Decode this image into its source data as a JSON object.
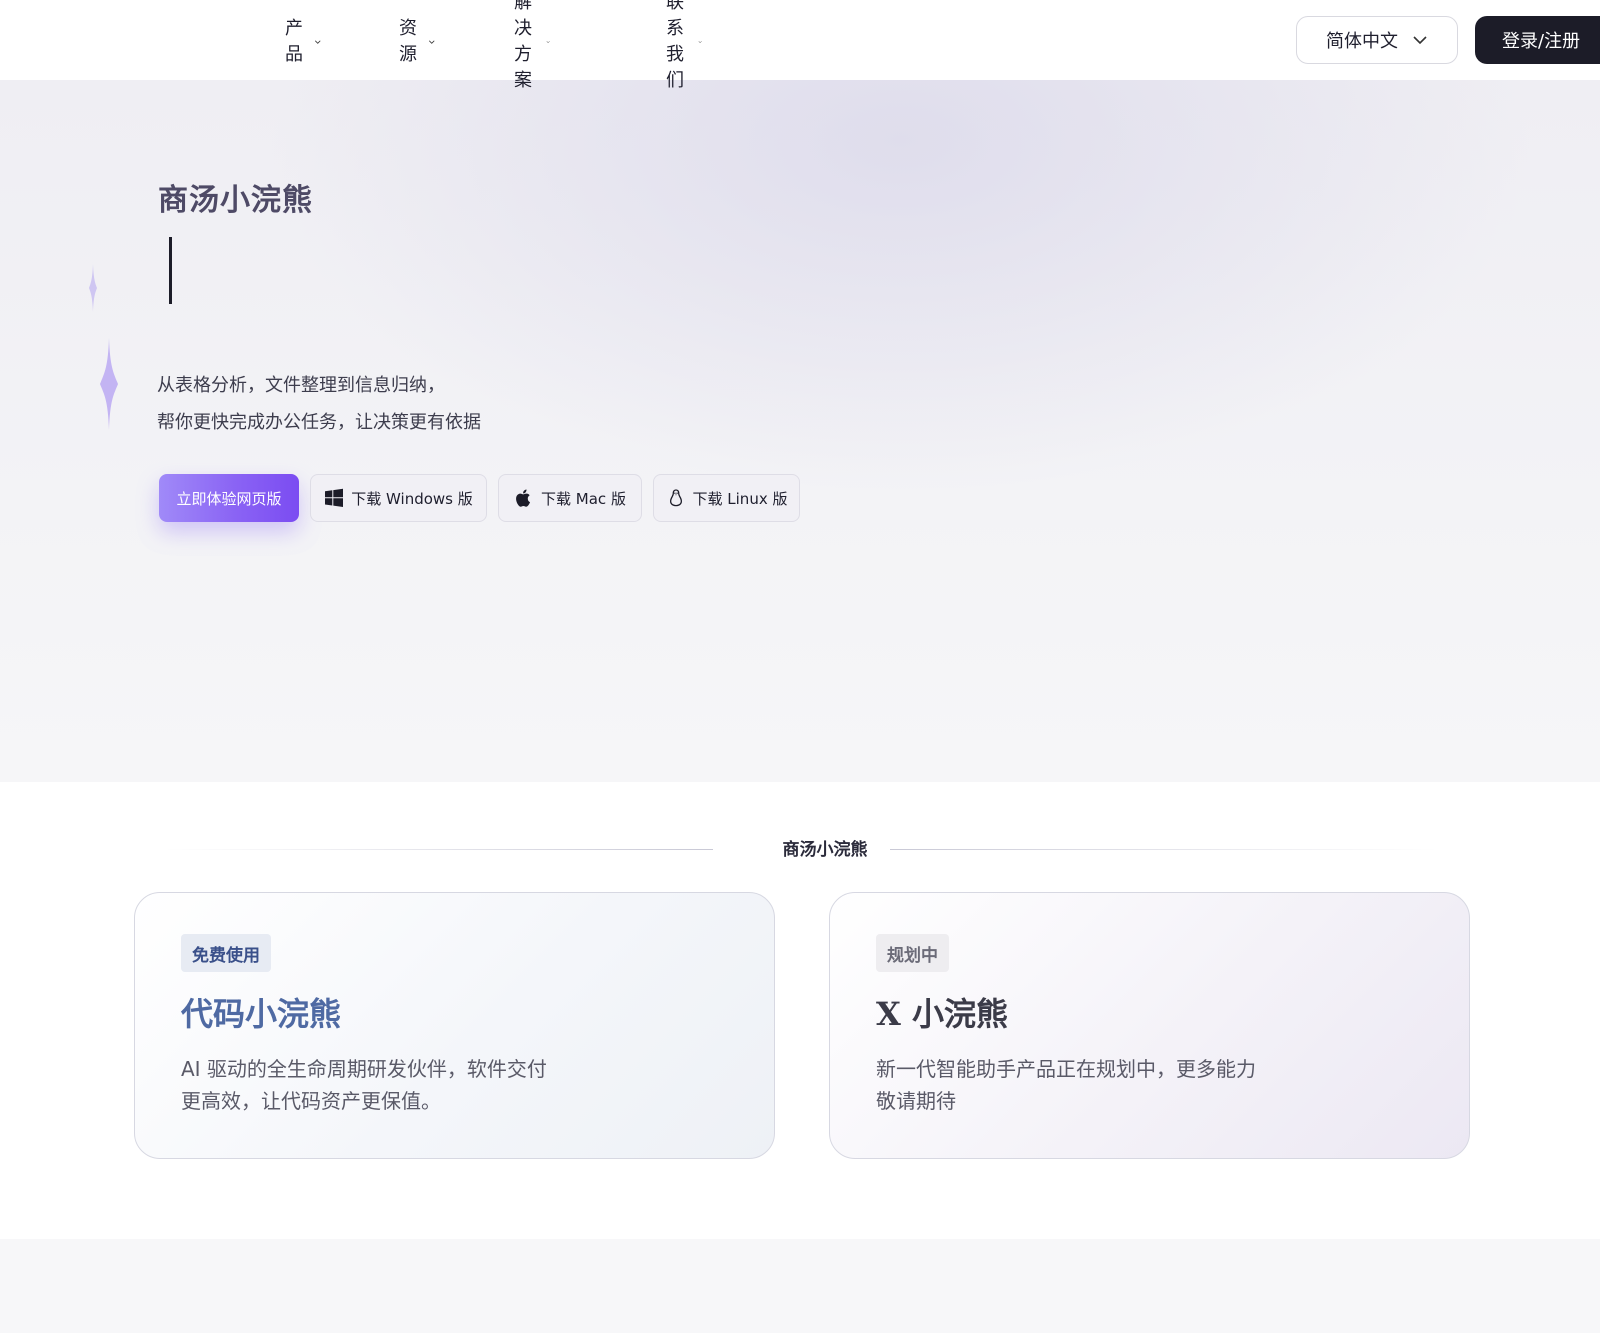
{
  "header": {
    "nav": [
      {
        "label": "产品"
      },
      {
        "label": "资源"
      },
      {
        "label": "解决方案"
      },
      {
        "label": "联系我们"
      }
    ],
    "language": "简体中文",
    "login": "登录/注册"
  },
  "hero": {
    "brand": "商汤小浣熊",
    "desc_line1": "从表格分析，文件整理到信息归纳，",
    "desc_line2": "帮你更快完成办公任务，让决策更有依据",
    "cta_web": "立即体验网页版",
    "dl_windows": "下载 Windows 版",
    "dl_mac": "下载 Mac 版",
    "dl_linux": "下载 Linux 版"
  },
  "products": {
    "section_title": "商汤小浣熊",
    "cards": [
      {
        "badge": "免费使用",
        "title": "代码小浣熊",
        "desc": "AI 驱动的全生命周期研发伙伴，软件交付更高效，让代码资产更保值。"
      },
      {
        "badge": "规划中",
        "title": "X 小浣熊",
        "desc": "新一代智能助手产品正在规划中，更多能力敬请期待"
      }
    ]
  },
  "colors": {
    "accent": "#8a63f4",
    "dark": "#1c1c28",
    "code_card_title": "#4f6aa3"
  }
}
